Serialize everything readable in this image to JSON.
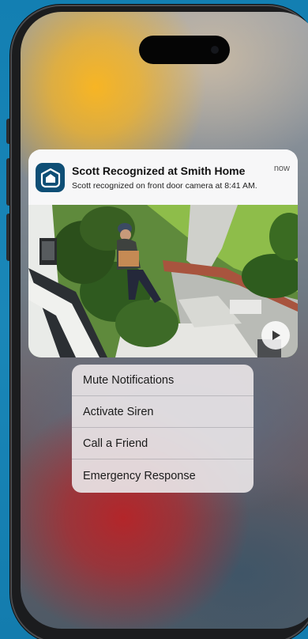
{
  "notification": {
    "app_icon": "home-shield-icon",
    "title": "Scott Recognized at Smith Home",
    "time": "now",
    "body": "Scott recognized on front door camera at 8:41 AM.",
    "preview_icon": "play-icon"
  },
  "actions": {
    "items": [
      {
        "label": "Mute Notifications"
      },
      {
        "label": "Activate Siren"
      },
      {
        "label": "Call a Friend"
      },
      {
        "label": "Emergency Response"
      }
    ]
  }
}
